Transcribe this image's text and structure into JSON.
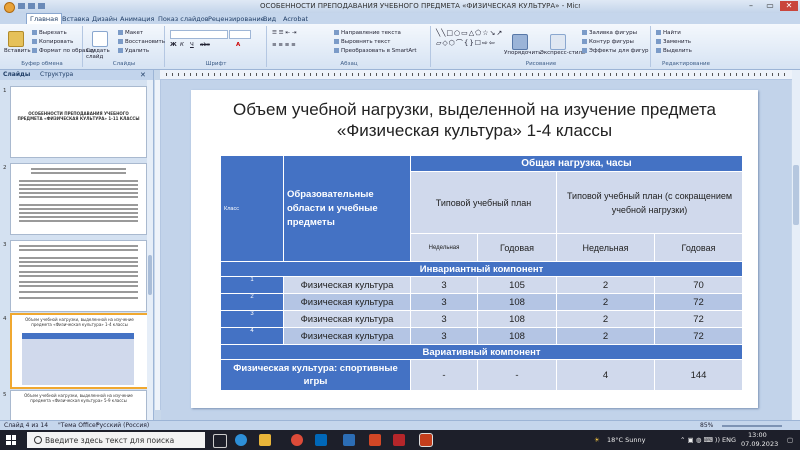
{
  "window": {
    "title": "ОСОБЕННОСТИ ПРЕПОДАВАНИЯ УЧЕБНОГО ПРЕДМЕТА «ФИЗИЧЕСКАЯ КУЛЬТУРА» - Microsoft PowerPoint"
  },
  "ribbon": {
    "tabs": [
      "Главная",
      "Вставка",
      "Дизайн",
      "Анимация",
      "Показ слайдов",
      "Рецензирование",
      "Вид",
      "Acrobat"
    ],
    "clipboard": {
      "paste": "Вставить",
      "cut": "Вырезать",
      "copy": "Копировать",
      "format_painter": "Формат по образцу",
      "label": "Буфер обмена"
    },
    "slides": {
      "new_slide": "Создать слайд",
      "layout": "Макет",
      "reset": "Восстановить",
      "delete": "Удалить",
      "label": "Слайды"
    },
    "font": {
      "label": "Шрифт"
    },
    "paragraph": {
      "text_direction": "Направление текста",
      "align_text": "Выровнять текст",
      "smartart": "Преобразовать в SmartArt",
      "label": "Абзац"
    },
    "drawing": {
      "arrange": "Упорядочить",
      "quick_styles": "Экспресс-стили",
      "shape_fill": "Заливка фигуры",
      "shape_outline": "Контур фигуры",
      "shape_effects": "Эффекты для фигур",
      "label": "Рисование"
    },
    "editing": {
      "find": "Найти",
      "replace": "Заменить",
      "select": "Выделить",
      "label": "Редактирование"
    }
  },
  "left_panel": {
    "tabs": [
      "Слайды",
      "Структура"
    ],
    "thumbs": [
      {
        "num": "1",
        "title": "ОСОБЕННОСТИ ПРЕПОДАВАНИЯ УЧЕБНОГО ПРЕДМЕТА «ФИЗИЧЕСКАЯ КУЛЬТУРА» 1-11 КЛАССЫ"
      },
      {
        "num": "2",
        "title": ""
      },
      {
        "num": "3",
        "title": ""
      },
      {
        "num": "4",
        "title": "Объем учебной нагрузки, выделенной на изучение предмета «Физическая культура» 1-4 классы"
      },
      {
        "num": "5",
        "title": "Объем учебной нагрузки, выделенной на изучение предмета «Физическая культура» 5-9 классы"
      }
    ]
  },
  "slide": {
    "title": "Объем учебной нагрузки, выделенной на изучение предмета «Физическая культура» 1-4 классы",
    "table": {
      "h_class": "Класс",
      "h_area": "Образовательные области и учебные предметы",
      "h_total": "Общая нагрузка, часы",
      "h_typical": "Типовой учебный план",
      "h_reduced": "Типовой учебный план (с сокращением учебной нагрузки)",
      "h_weekly_a": "Недельная",
      "h_yearly_a": "Годовая",
      "h_weekly_b": "Недельная",
      "h_yearly_b": "Годовая",
      "invariant": "Инвариантный компонент",
      "rows": [
        {
          "grade": "1",
          "subject": "Физическая культура",
          "w1": "3",
          "y1": "105",
          "w2": "2",
          "y2": "70"
        },
        {
          "grade": "2",
          "subject": "Физическая культура",
          "w1": "3",
          "y1": "108",
          "w2": "2",
          "y2": "72"
        },
        {
          "grade": "3",
          "subject": "Физическая культура",
          "w1": "3",
          "y1": "108",
          "w2": "2",
          "y2": "72"
        },
        {
          "grade": "4",
          "subject": "Физическая культура",
          "w1": "3",
          "y1": "108",
          "w2": "2",
          "y2": "72"
        }
      ],
      "variative": "Вариативный компонент",
      "var_row": {
        "subject": "Физическая культура: спортивные игры",
        "w1": "-",
        "y1": "-",
        "w2": "4",
        "y2": "144"
      }
    }
  },
  "status_bar": {
    "slide": "Слайд 4 из 14",
    "theme": "\"Тема Office\"",
    "lang": "Русский (Россия)",
    "zoom": "85%"
  },
  "taskbar": {
    "search_placeholder": "Введите здесь текст для поиска",
    "weather": "18°C Sunny",
    "lang": "ENG",
    "time": "13:00",
    "date": "07.09.2023"
  },
  "colors": {
    "header_blue": "#4472c4",
    "row_light": "#d0d9ec",
    "row_mid": "#b4c5e4",
    "ribbon": "#d6e3f3"
  }
}
